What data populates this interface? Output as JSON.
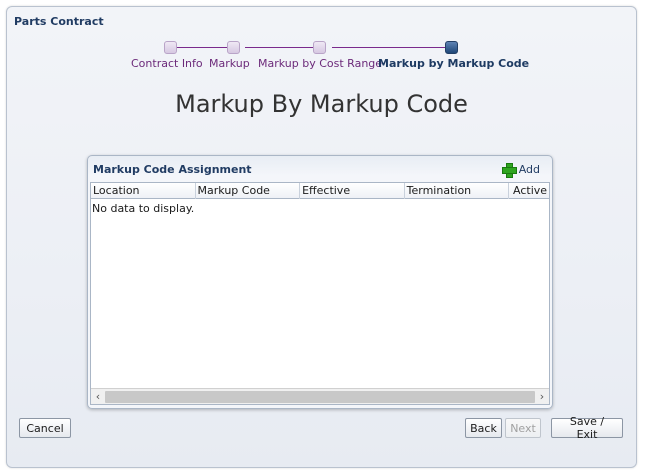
{
  "window": {
    "title": "Parts Contract"
  },
  "train": {
    "stops": [
      {
        "label": "Contract Info",
        "state": "visited"
      },
      {
        "label": "Markup",
        "state": "visited"
      },
      {
        "label": "Markup by Cost Range",
        "state": "visited"
      },
      {
        "label": "Markup by Markup Code",
        "state": "current"
      }
    ]
  },
  "page": {
    "title": "Markup By Markup Code"
  },
  "panel": {
    "title": "Markup Code Assignment",
    "add_label": "Add",
    "columns": [
      "Location",
      "Markup Code",
      "Effective",
      "Termination",
      "Active"
    ],
    "empty_text": "No data to display."
  },
  "buttons": {
    "cancel": "Cancel",
    "back": "Back",
    "next": "Next",
    "save_exit": "Save / Exit"
  },
  "colors": {
    "train_visited": "#7a2a8c",
    "train_current": "#1f4778",
    "add_icon": "#2fa51f"
  }
}
